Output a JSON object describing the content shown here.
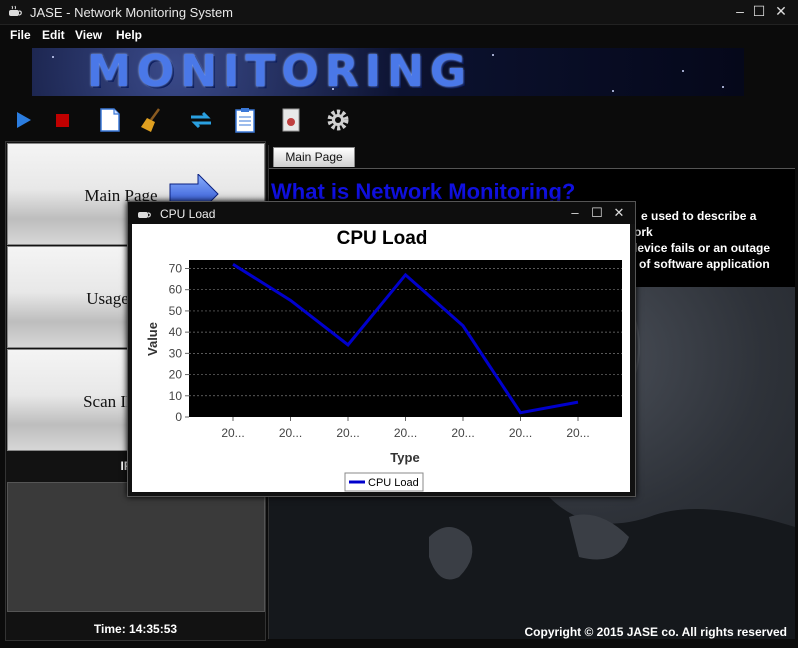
{
  "app": {
    "title": "JASE - Network Monitoring System",
    "controls": [
      "–",
      "☐",
      "✕"
    ]
  },
  "menu": [
    "File",
    "Edit",
    "View",
    "Help"
  ],
  "banner": {
    "text": "MONITORING"
  },
  "toolbar": [
    {
      "name": "play-icon",
      "color": "#2b7de0"
    },
    {
      "name": "stop-icon",
      "color": "#c00000"
    },
    {
      "name": "new-document-icon",
      "color": "#3a78d8"
    },
    {
      "name": "broom-icon",
      "color": "#e0a020"
    },
    {
      "name": "refresh-icon",
      "color": "#2aa0e0"
    },
    {
      "name": "clipboard-icon",
      "color": "#3a78d8"
    },
    {
      "name": "report-icon",
      "color": "#c04040"
    },
    {
      "name": "gear-icon",
      "color": "#d0d0d0"
    }
  ],
  "sidebar": {
    "buttons": [
      {
        "label": "Main Page"
      },
      {
        "label": "Usage Tre"
      },
      {
        "label": "Scan IP Ad"
      }
    ],
    "ip_label": "IP Ad",
    "time": "Time: 14:35:53"
  },
  "main": {
    "tab": "Main Page",
    "heading": "What is Network Monitoring?",
    "lines": [
      "e used to describe a",
      "ork",
      "levice fails or an outage",
      "of software application"
    ],
    "copyright": "Copyright © 2015 JASE co.  All rights reserved"
  },
  "dialog": {
    "title": "CPU Load",
    "controls": [
      "–",
      "☐",
      "✕"
    ]
  },
  "chart_data": {
    "type": "line",
    "title": "CPU Load",
    "xlabel": "Type",
    "ylabel": "Value",
    "categories": [
      "20...",
      "20...",
      "20...",
      "20...",
      "20...",
      "20...",
      "20..."
    ],
    "series": [
      {
        "name": "CPU Load",
        "values": [
          72,
          55,
          34,
          67,
          43,
          2,
          7
        ],
        "color": "#0000cc"
      }
    ],
    "ylim": [
      0,
      74
    ],
    "yticks": [
      0,
      10,
      20,
      30,
      40,
      50,
      60,
      70
    ],
    "grid": true,
    "plot_background": "#000000",
    "legend": "bottom"
  }
}
